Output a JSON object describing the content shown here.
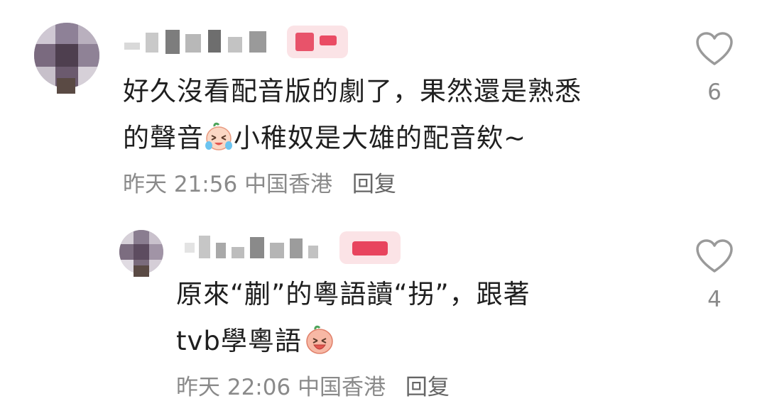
{
  "comments": [
    {
      "text_line1": "好久沒看配音版的劇了，果然還是熟悉",
      "text_line2_a": "的聲音",
      "text_line2_b": "小稚奴是大雄的配音欸~",
      "emoji_icon": "laugh-cry-face-icon",
      "time": "昨天 21:56",
      "location": "中国香港",
      "reply_label": "回复",
      "like_count": "6",
      "avatar_colors": [
        "#8e8197",
        "#6b5a6e",
        "#a89cae",
        "#4e3f4f"
      ]
    },
    {
      "text_line1": "原來“蒯”的粵語讀“拐”，跟著",
      "text_line2_a": "tvb學粵語",
      "emoji_icon": "grinning-face-icon",
      "time": "昨天 22:06",
      "location": "中国香港",
      "reply_label": "回复",
      "like_count": "4",
      "avatar_colors": [
        "#8a7d90",
        "#5d4c60",
        "#b2a8b6",
        "#c9c1cc"
      ]
    }
  ]
}
